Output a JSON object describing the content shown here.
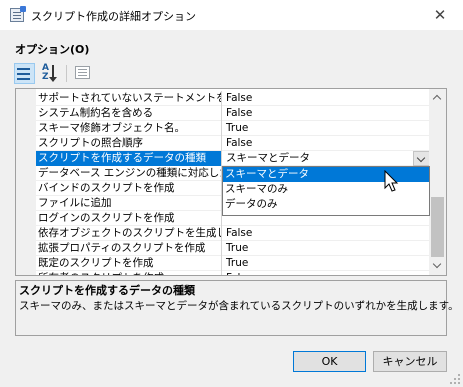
{
  "window": {
    "title": "スクリプト作成の詳細オプション",
    "close_glyph": "✕"
  },
  "section": {
    "label": "オプション(O)"
  },
  "toolbar": {
    "alpha_top": "A",
    "alpha_bottom": "Z",
    "buttons": [
      "categorized-view",
      "alphabetical-sort",
      "property-pages"
    ]
  },
  "grid": {
    "rows": [
      {
        "name": "サポートされていないステートメントを含む",
        "value": "False"
      },
      {
        "name": "システム制約名を含める",
        "value": "False"
      },
      {
        "name": "スキーマ修飾オブジェクト名。",
        "value": "True"
      },
      {
        "name": "スクリプトの照合順序",
        "value": "False"
      },
      {
        "name": "スクリプトを作成するデータの種類",
        "value": "スキーマとデータ"
      },
      {
        "name": "データベース エンジンの種類に対応したスクリプト",
        "value": ""
      },
      {
        "name": "バインドのスクリプトを作成",
        "value": ""
      },
      {
        "name": "ファイルに追加",
        "value": ""
      },
      {
        "name": "ログインのスクリプトを作成",
        "value": ""
      },
      {
        "name": "依存オブジェクトのスクリプトを生成します",
        "value": "False"
      },
      {
        "name": "拡張プロパティのスクリプトを作成",
        "value": "True"
      },
      {
        "name": "既定のスクリプトを作成",
        "value": "True"
      },
      {
        "name": "所有者のスクリプトを作成",
        "value": "False"
      }
    ],
    "selected_index": 4
  },
  "dropdown": {
    "options": [
      "スキーマとデータ",
      "スキーマのみ",
      "データのみ"
    ],
    "highlighted_index": 0
  },
  "description": {
    "title": "スクリプトを作成するデータの種類",
    "text": "スキーマのみ、またはスキーマとデータが含まれているスクリプトのいずれかを生成します。"
  },
  "buttons": {
    "ok": "OK",
    "cancel": "キャンセル"
  },
  "colors": {
    "selection": "#0078d7",
    "background": "#f0f0f0"
  }
}
